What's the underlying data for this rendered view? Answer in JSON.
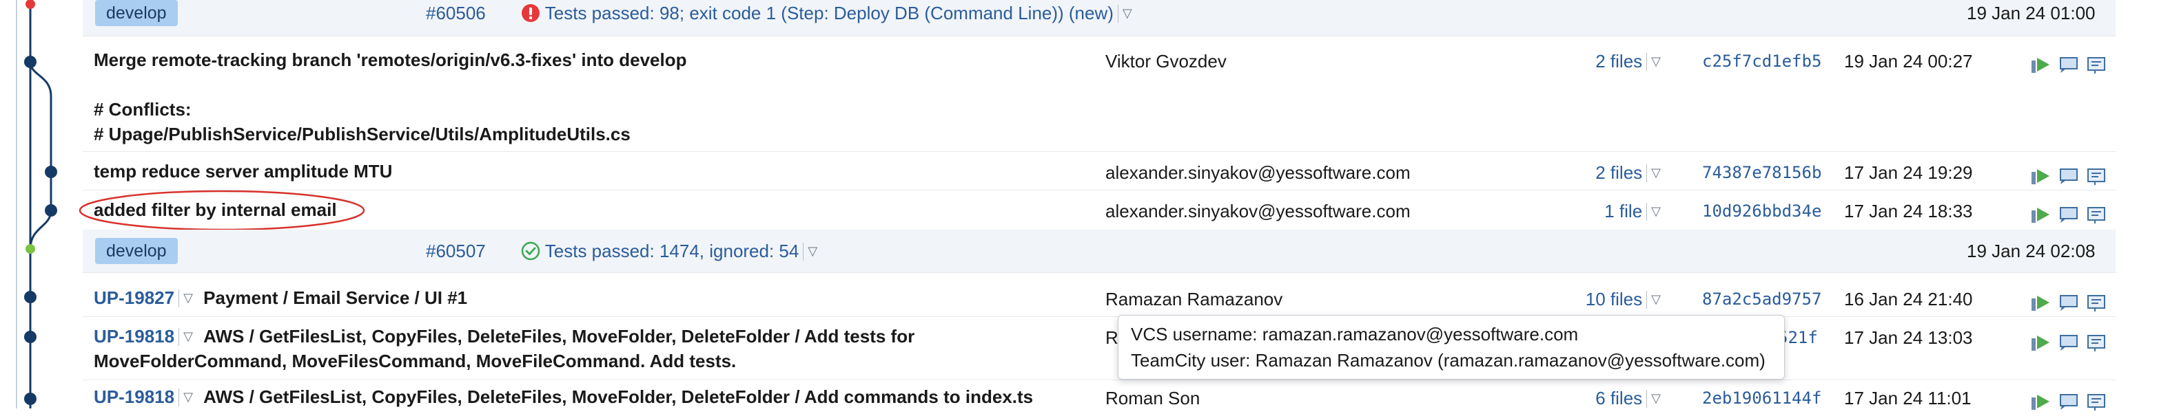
{
  "rows": [
    {
      "kind": "build",
      "branch": "develop",
      "build_number": "#60506",
      "status_icon": "error-circle-icon",
      "status_color": "#e5383b",
      "status_text": "Tests passed: 98; exit code 1 (Step: Deploy DB (Command Line)) (new)",
      "date": "19 Jan 24 01:00"
    },
    {
      "kind": "commit",
      "message_lines": [
        "Merge remote-tracking branch 'remotes/origin/v6.3-fixes' into develop",
        "",
        "# Conflicts:",
        "# Upage/PublishService/PublishService/Utils/AmplitudeUtils.cs"
      ],
      "author": "Viktor Gvozdev",
      "files": "2 files",
      "hash": "c25f7cd1efb5",
      "date": "19 Jan 24 00:27"
    },
    {
      "kind": "commit",
      "message_lines": [
        "temp reduce server amplitude MTU"
      ],
      "author": "alexander.sinyakov@yessoftware.com",
      "files": "2 files",
      "hash": "74387e78156b",
      "date": "17 Jan 24 19:29"
    },
    {
      "kind": "commit",
      "message_lines": [
        "added filter by internal email"
      ],
      "author": "alexander.sinyakov@yessoftware.com",
      "files": "1 file",
      "hash": "10d926bbd34e",
      "date": "17 Jan 24 18:33"
    },
    {
      "kind": "build",
      "branch": "develop",
      "build_number": "#60507",
      "status_icon": "success-check-icon",
      "status_color": "#3aa853",
      "status_text": "Tests passed: 1474, ignored: 54",
      "date": "19 Jan 24 02:08"
    },
    {
      "kind": "commit",
      "issue": "UP-19827",
      "message_lines": [
        "Payment / Email Service / UI #1"
      ],
      "author": "Ramazan Ramazanov",
      "files": "10 files",
      "hash": "87a2c5ad9757",
      "date": "16 Jan 24 21:40"
    },
    {
      "kind": "commit",
      "issue": "UP-19818",
      "message_lines": [
        "AWS / GetFilesList, CopyFiles, DeleteFiles, MoveFolder, DeleteFolder / Add tests for",
        "MoveFolderCommand, MoveFilesCommand, MoveFileCommand. Add tests."
      ],
      "author": "Ro",
      "files": "",
      "hash": "521f",
      "date": "17 Jan 24 13:03"
    },
    {
      "kind": "commit",
      "issue": "UP-19818",
      "message_lines": [
        "AWS / GetFilesList, CopyFiles, DeleteFiles, MoveFolder, DeleteFolder / Add commands to index.ts"
      ],
      "author": "Roman Son",
      "files": "6 files",
      "hash": "2eb19061144f",
      "date": "17 Jan 24 11:01"
    }
  ],
  "tooltip": {
    "vcs_line": "VCS username: ramazan.ramazanov@yessoftware.com",
    "tc_line": "TeamCity user: Ramazan Ramazanov (ramazan.ramazanov@yessoftware.com)"
  },
  "colors": {
    "link": "#2a5c9b",
    "graph_line": "#163a66",
    "annotation": "#d8312b",
    "badge": "#a8cdf1"
  },
  "icon_names": [
    "run-build-icon",
    "comment-icon",
    "changes-details-icon"
  ]
}
